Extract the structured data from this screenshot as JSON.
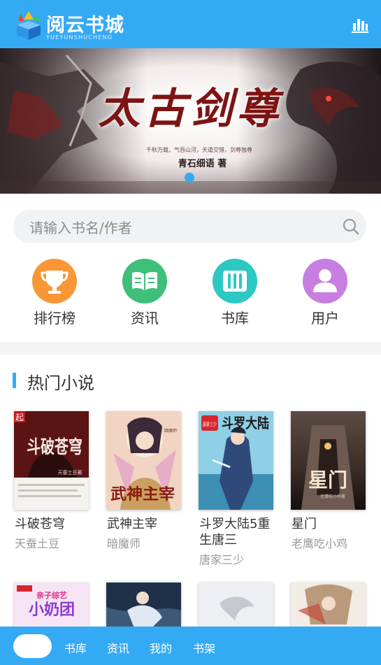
{
  "header": {
    "logo_title": "阅云书城",
    "logo_subtitle": "YUEYUNSHUCHENG",
    "chart_icon": "bar-chart-icon"
  },
  "banner": {
    "title": "太古剑尊",
    "tagline": "千秋万载，气吞山河，天道交错，剑尊独尊",
    "author": "青石细语 著",
    "slide_count": 1,
    "active_slide": 1
  },
  "search": {
    "placeholder": "请输入书名/作者",
    "icon": "search-icon"
  },
  "nav": [
    {
      "label": "排行榜",
      "icon": "trophy-icon",
      "color": "#f99737"
    },
    {
      "label": "资讯",
      "icon": "open-book-icon",
      "color": "#3ec07a"
    },
    {
      "label": "书库",
      "icon": "bookshelf-icon",
      "color": "#2cc9c3"
    },
    {
      "label": "用户",
      "icon": "user-icon",
      "color": "#c67ee0"
    }
  ],
  "section": {
    "title": "热门小说"
  },
  "books": [
    {
      "title": "斗破苍穹",
      "author": "天蚕土豆"
    },
    {
      "title": "武神主宰",
      "author": "暗魔师"
    },
    {
      "title": "斗罗大陆5重生唐三",
      "author": "唐家三少"
    },
    {
      "title": "星门",
      "author": "老鹰吃小鸡"
    }
  ],
  "cover_texts": {
    "b1_publisher": "起",
    "b1_title": "斗破苍穹",
    "b1_author": "天蚕土豆著",
    "b2_title": "武神主宰",
    "b2_author": "暗魔师",
    "b3_title": "斗罗大陆",
    "b3_tag": "唐家三少",
    "b4_title": "星门",
    "b4_author": "老鹰吃小鸡著",
    "b5_title": "小奶团",
    "b5_tag": "亲子综艺"
  },
  "bottom_nav": {
    "items": [
      "书库",
      "资讯",
      "我的",
      "书架"
    ]
  },
  "colors": {
    "accent": "#35aaf4",
    "text": "#333333",
    "muted": "#999999"
  }
}
